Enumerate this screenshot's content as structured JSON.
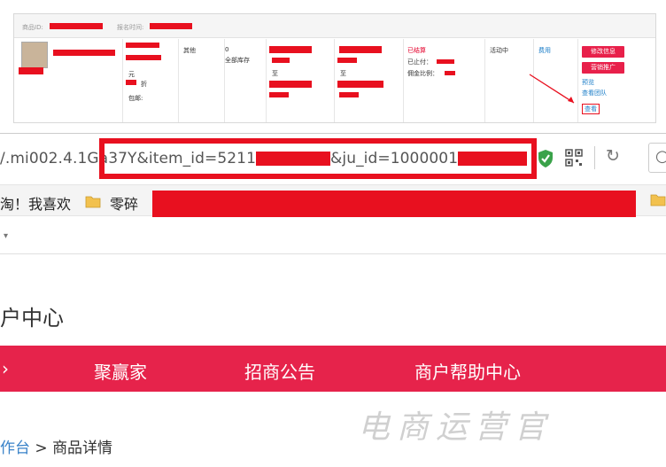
{
  "order_table": {
    "product_id_label": "商品ID:",
    "signup_time_label": "报名时间:",
    "category": "其他",
    "stock_value": "0",
    "stock_label": "全部库存",
    "to_1": "至",
    "to_2": "至",
    "price_unit": "元",
    "discount": "折",
    "shipping": "包邮:",
    "settle_status": "已结算",
    "paid_label": "已止付：",
    "commission_label": "佣金比例：",
    "activity_status": "活动中",
    "fee": "费用",
    "btn_edit": "修改信息",
    "btn_promote": "营销推广",
    "link_preview": "预览",
    "link_view_team": "查看团队",
    "link_view": "查看"
  },
  "browser": {
    "url_start": "/.mi002.4.1Ga",
    "url_mid": "37Y&item_id=5211",
    "url_mid2": "&ju_id=1000001",
    "bookmark_text": "淘！我喜欢",
    "bookmark_folder": "零碎",
    "tab_caret": "▾"
  },
  "page": {
    "title": "户中心",
    "nav": [
      "聚赢家",
      "招商公告",
      "商户帮助中心"
    ],
    "breadcrumb_link": "作台",
    "breadcrumb_sep": " > ",
    "breadcrumb_current": "商品详情",
    "watermark": "电商运营官"
  },
  "colors": {
    "accent_red": "#e6234b",
    "redaction": "#e8101f",
    "link_blue": "#1e7fc9"
  }
}
